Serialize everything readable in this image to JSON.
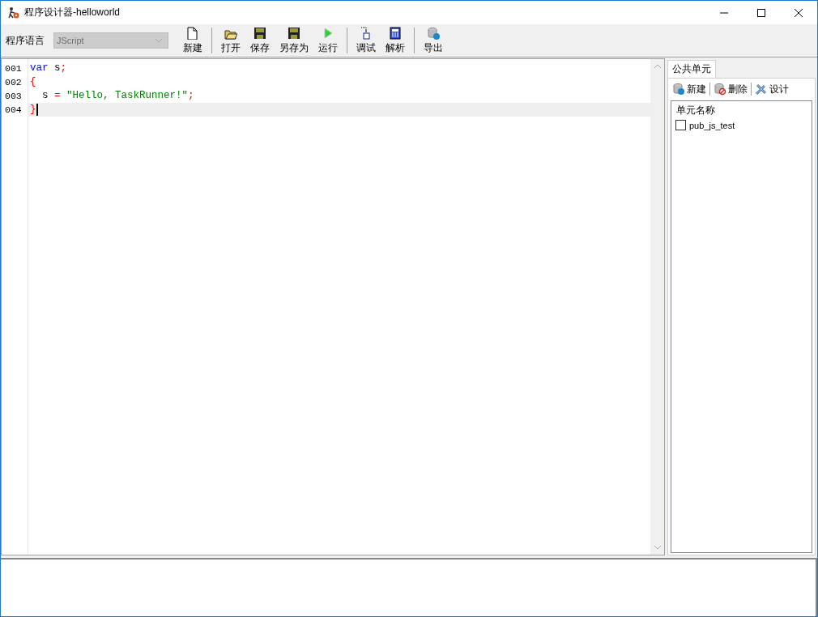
{
  "window": {
    "title": "程序设计器-helloworld"
  },
  "toolbar": {
    "language_label": "程序语言",
    "language": {
      "value": "JScript",
      "disabled": true
    },
    "groups": [
      [
        {
          "label": "新建",
          "kind": "new"
        }
      ],
      [
        {
          "label": "打开",
          "kind": "open"
        },
        {
          "label": "保存",
          "kind": "save"
        },
        {
          "label": "另存为",
          "kind": "save"
        },
        {
          "label": "运行",
          "kind": "run"
        }
      ],
      [
        {
          "label": "调试",
          "kind": "debug"
        },
        {
          "label": "解析",
          "kind": "calc"
        }
      ],
      [
        {
          "label": "导出",
          "kind": "export"
        }
      ]
    ]
  },
  "editor": {
    "lines": [
      {
        "number": "001",
        "current": false,
        "tokens": [
          {
            "kind": "keyword",
            "text": "var"
          },
          {
            "kind": "plain",
            "text": " s"
          },
          {
            "kind": "punct",
            "text": ";"
          }
        ]
      },
      {
        "number": "002",
        "current": false,
        "tokens": [
          {
            "kind": "punct",
            "text": "{"
          }
        ]
      },
      {
        "number": "003",
        "current": false,
        "tokens": [
          {
            "kind": "plain",
            "text": "  s "
          },
          {
            "kind": "punct",
            "text": "= "
          },
          {
            "kind": "string",
            "text": "\"Hello, TaskRunner!\""
          },
          {
            "kind": "punct",
            "text": ";"
          }
        ]
      },
      {
        "number": "004",
        "current": true,
        "tokens": [
          {
            "kind": "punct",
            "text": "}"
          }
        ]
      }
    ]
  },
  "units_panel": {
    "tab": {
      "label": "公共单元",
      "selected": true
    },
    "buttons": [
      {
        "label": "新建",
        "kind": "add"
      },
      {
        "label": "删除",
        "kind": "delete"
      },
      {
        "label": "设计",
        "kind": "design"
      }
    ],
    "column": "单元名称",
    "items": [
      {
        "name": "pub_js_test",
        "checked": false
      }
    ]
  }
}
